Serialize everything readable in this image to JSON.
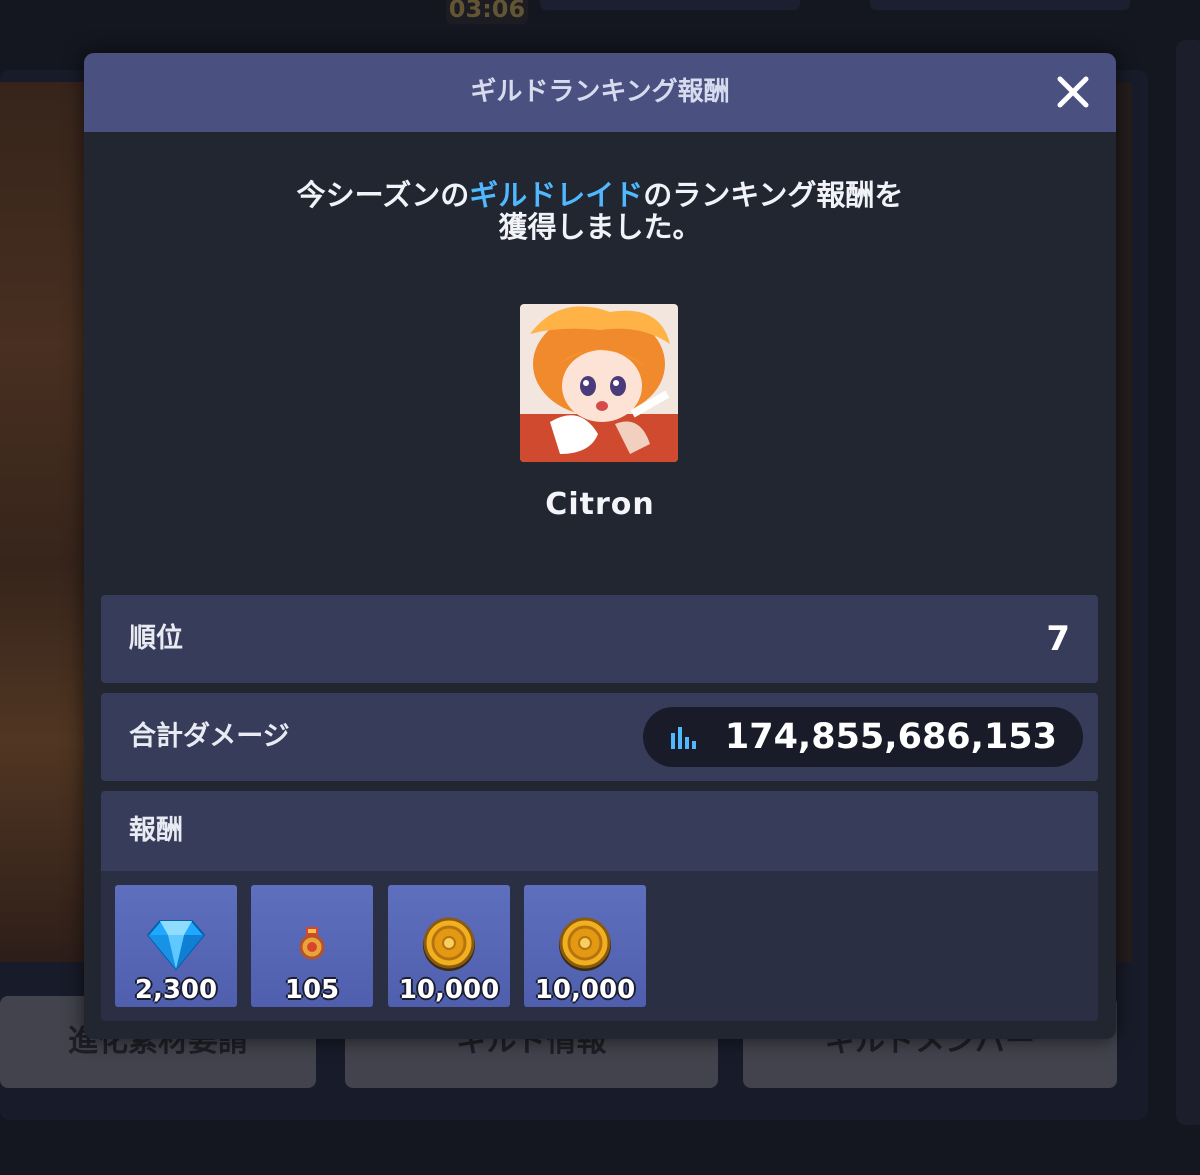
{
  "background": {
    "timer": "03:06",
    "buttons": [
      "進化素材要請",
      "ギルド情報",
      "ギルドメンバー"
    ]
  },
  "modal": {
    "title": "ギルドランキング報酬",
    "message": {
      "prefix": "今シーズンの",
      "highlight": "ギルドレイド",
      "suffix": "のランキング報酬を",
      "line2": "獲得しました。"
    },
    "player": {
      "name": "Citron",
      "avatar": "player-avatar-portrait"
    },
    "rank": {
      "label": "順位",
      "value": "7"
    },
    "damage": {
      "label": "合計ダメージ",
      "value": "174,855,686,153",
      "icon": "bar-chart-icon"
    },
    "rewards": {
      "label": "報酬",
      "items": [
        {
          "icon": "diamond-icon",
          "count": "2,300"
        },
        {
          "icon": "medal-icon",
          "count": "105"
        },
        {
          "icon": "gold-coin-icon",
          "count": "10,000"
        },
        {
          "icon": "gold-coin-icon",
          "count": "10,000"
        }
      ]
    }
  },
  "colors": {
    "header": "#4a5181",
    "highlight": "#4fb8ff",
    "row": "#363c59",
    "reward_tile": "#5565b5"
  }
}
